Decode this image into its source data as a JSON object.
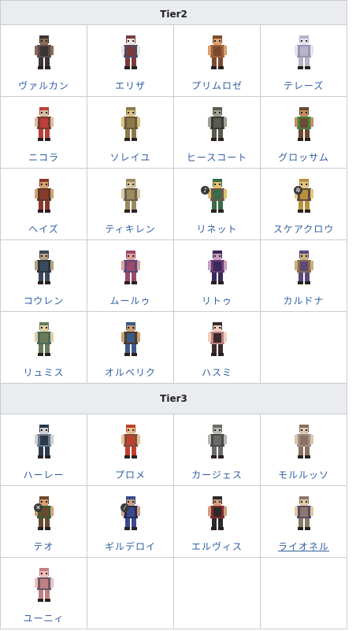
{
  "tiers": [
    {
      "label": "Tier2",
      "rows": [
        [
          {
            "name": "ヴァルカン",
            "colors": [
              "#3b3436",
              "#8a6c57",
              "#5a4a4e"
            ]
          },
          {
            "name": "エリザ",
            "colors": [
              "#7a3c3a",
              "#e8e4de",
              "#4e4a66"
            ]
          },
          {
            "name": "プリムロゼ",
            "colors": [
              "#7a4a2e",
              "#d9a070",
              "#a0603a"
            ]
          },
          {
            "name": "テレーズ",
            "colors": [
              "#b8b4c8",
              "#e6e2f0",
              "#9a96b0"
            ]
          }
        ],
        [
          {
            "name": "ニコラ",
            "colors": [
              "#b84038",
              "#d8c0a0",
              "#7a3a34"
            ]
          },
          {
            "name": "ソレイユ",
            "colors": [
              "#8a7a4a",
              "#d8c080",
              "#6a5a3a"
            ]
          },
          {
            "name": "ヒースコート",
            "colors": [
              "#5a5a50",
              "#a0a090",
              "#3a3a36"
            ]
          },
          {
            "name": "グロッサム",
            "colors": [
              "#6a4a30",
              "#c09060",
              "#4a8040"
            ]
          }
        ],
        [
          {
            "name": "ヘイズ",
            "colors": [
              "#8a3a2a",
              "#d8a070",
              "#5a3a30"
            ]
          },
          {
            "name": "ティキレン",
            "colors": [
              "#9a8a60",
              "#d8c8a0",
              "#6a6050"
            ]
          },
          {
            "name": "リネット",
            "colors": [
              "#3a6a4a",
              "#e0c070",
              "#6a5a4a"
            ]
          },
          {
            "name": "スケアクロウ",
            "colors": [
              "#b89040",
              "#e0c880",
              "#5a4a3a"
            ]
          }
        ],
        [
          {
            "name": "コウレン",
            "colors": [
              "#3a4a5a",
              "#b8a080",
              "#2a3640"
            ]
          },
          {
            "name": "ムールゥ",
            "colors": [
              "#9a4a6a",
              "#e0a0a0",
              "#5a4a7a"
            ]
          },
          {
            "name": "リトゥ",
            "colors": [
              "#3a2a5a",
              "#c8a0c0",
              "#6a3a7a"
            ]
          },
          {
            "name": "カルドナ",
            "colors": [
              "#5a4a7a",
              "#c8b080",
              "#8a6a50"
            ]
          }
        ],
        [
          {
            "name": "リュミス",
            "colors": [
              "#6a7a5a",
              "#e0d0a0",
              "#4a6a5a"
            ]
          },
          {
            "name": "オルベリク",
            "colors": [
              "#3a5a8a",
              "#c8a070",
              "#4a3a2a"
            ]
          },
          {
            "name": "ハスミ",
            "colors": [
              "#3a2a2a",
              "#f0d0c0",
              "#c08080"
            ]
          },
          null
        ]
      ]
    },
    {
      "label": "Tier3",
      "rows": [
        [
          {
            "name": "ハーレー",
            "colors": [
              "#2a3a4a",
              "#d0d0d8",
              "#6a7a8a"
            ]
          },
          {
            "name": "プロメ",
            "colors": [
              "#c04030",
              "#e8c090",
              "#7a5040"
            ]
          },
          {
            "name": "カージェス",
            "colors": [
              "#6a6a6a",
              "#b8b8b0",
              "#4a4a4a"
            ]
          },
          {
            "name": "モルルッソ",
            "colors": [
              "#8a7060",
              "#d8c8b0",
              "#a09080"
            ]
          }
        ],
        [
          {
            "name": "テオ",
            "colors": [
              "#6a4a30",
              "#d8a070",
              "#3a5a3a"
            ]
          },
          {
            "name": "ギルデロイ",
            "colors": [
              "#3a4a8a",
              "#c8a080",
              "#2a2a5a"
            ]
          },
          {
            "name": "エルヴィス",
            "colors": [
              "#2a2a2a",
              "#d0a080",
              "#8a2a2a"
            ]
          },
          {
            "name": "ライオネル",
            "colors": [
              "#8a7a6a",
              "#e0c8a0",
              "#5a4a6a"
            ]
          }
        ],
        [
          {
            "name": "ユーニィ",
            "colors": [
              "#c08080",
              "#f0c0c0",
              "#6a5a6a"
            ]
          },
          null,
          null,
          null
        ]
      ]
    }
  ],
  "badges": {
    "リネット": "mic-icon",
    "スケアクロウ": "gear-icon",
    "テオ": "close-icon",
    "ギルデロイ": "slash-icon"
  },
  "badge_glyphs": {
    "mic-icon": "♪",
    "gear-icon": "✲",
    "close-icon": "✕",
    "slash-icon": "⁄"
  },
  "underlined": [
    "ライオネル"
  ]
}
